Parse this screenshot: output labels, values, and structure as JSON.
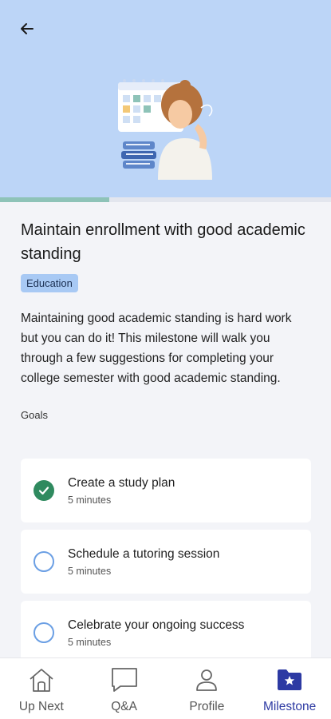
{
  "header": {
    "back_icon": "arrow-left-icon",
    "illustration": "student-with-calendar-and-books-illustration",
    "progress": 0.33
  },
  "milestone": {
    "title": "Maintain enrollment with good academic standing",
    "tag": "Education",
    "description": "Maintaining good academic standing is hard work but you can do it! This milestone will walk you through a few suggestions for completing your college semester with good academic standing."
  },
  "goals": {
    "label": "Goals",
    "items": [
      {
        "title": "Create a study plan",
        "time": "5 minutes",
        "completed": true
      },
      {
        "title": "Schedule a tutoring session",
        "time": "5 minutes",
        "completed": false
      },
      {
        "title": "Celebrate your ongoing success",
        "time": "5 minutes",
        "completed": false
      }
    ]
  },
  "nav": {
    "items": [
      {
        "label": "Up Next",
        "icon": "home-icon"
      },
      {
        "label": "Q&A",
        "icon": "chat-bubble-icon"
      },
      {
        "label": "Profile",
        "icon": "person-icon"
      },
      {
        "label": "Milestone",
        "icon": "star-folder-icon"
      }
    ],
    "active": "Milestone"
  },
  "colors": {
    "hero_bg": "#bcd5f7",
    "accent": "#2d3aa3",
    "success": "#2f8a5f",
    "tag_bg": "#a8c9f4"
  }
}
